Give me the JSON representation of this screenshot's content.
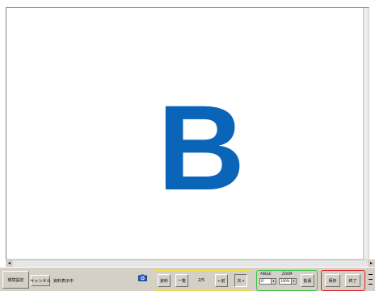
{
  "viewer": {
    "letter": "B",
    "letter_color": "#0a64b8"
  },
  "scroll": {
    "left_icon": "scroll-left-arrow-icon",
    "right_icon": "scroll-right-arrow-icon"
  },
  "toolbar": {
    "env_settings": "環境設定",
    "cancel": "キャンセル",
    "status": "資料表示中",
    "camera_icon": "camera-icon",
    "nav_group_color": "#f0e040",
    "view_group_color": "#40c040",
    "save_group_color": "#e02020",
    "material": "資料",
    "list": "一覧",
    "page": "2/5",
    "prev": "←前",
    "next": "次→",
    "angle_label": "ANGLE",
    "zoom_label": "ZOOM",
    "angle_value": "0°",
    "zoom_value": "100%",
    "enlarge": "拡張",
    "save": "保存",
    "end": "終了"
  }
}
